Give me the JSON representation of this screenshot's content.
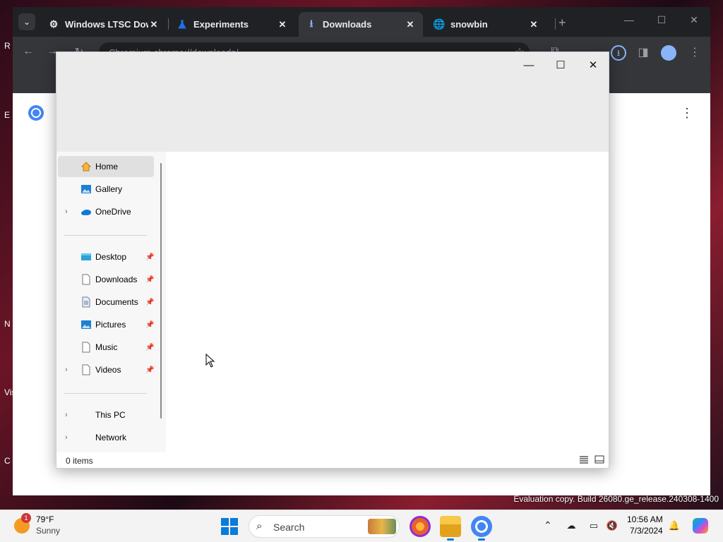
{
  "desktop": {
    "side_letters": [
      "R",
      "E",
      "N",
      "Vis",
      "C"
    ],
    "watermark": "Evaluation copy. Build 26080.ge_release.240308-1400"
  },
  "browser": {
    "tabs": [
      {
        "title": "Windows LTSC Dow",
        "icon": "gear-icon",
        "active": false
      },
      {
        "title": "Experiments",
        "icon": "flask-icon",
        "active": false
      },
      {
        "title": "Downloads",
        "icon": "download-icon",
        "active": true
      },
      {
        "title": "snowbin",
        "icon": "globe-icon",
        "active": false
      }
    ],
    "tab_close_glyph": "✕",
    "new_tab_glyph": "+",
    "omnibox_text": "Chromium  chrome://downloads/",
    "accent_color": "#8ab4f8"
  },
  "explorer": {
    "window_controls": {
      "minimize": "—",
      "maximize": "☐",
      "close": "✕"
    },
    "nav": {
      "top": [
        {
          "label": "Home",
          "icon": "home-icon",
          "chevron": false,
          "selected": true
        },
        {
          "label": "Gallery",
          "icon": "gallery-icon",
          "chevron": false,
          "selected": false
        },
        {
          "label": "OneDrive",
          "icon": "onedrive-icon",
          "chevron": true,
          "selected": false
        }
      ],
      "quick_access": [
        {
          "label": "Desktop",
          "icon": "desktop-folder-icon",
          "chevron": false
        },
        {
          "label": "Downloads",
          "icon": "downloads-folder-icon",
          "chevron": false
        },
        {
          "label": "Documents",
          "icon": "documents-folder-icon",
          "chevron": false
        },
        {
          "label": "Pictures",
          "icon": "pictures-folder-icon",
          "chevron": false
        },
        {
          "label": "Music",
          "icon": "music-folder-icon",
          "chevron": false
        },
        {
          "label": "Videos",
          "icon": "videos-folder-icon",
          "chevron": true
        }
      ],
      "bottom": [
        {
          "label": "This PC",
          "chevron": true
        },
        {
          "label": "Network",
          "chevron": true
        }
      ]
    },
    "status": "0 items"
  },
  "taskbar": {
    "weather": {
      "temp": "79°F",
      "condition": "Sunny",
      "badge": "1"
    },
    "search_label": "Search",
    "clock": {
      "time": "10:56 AM",
      "date": "7/3/2024"
    }
  }
}
